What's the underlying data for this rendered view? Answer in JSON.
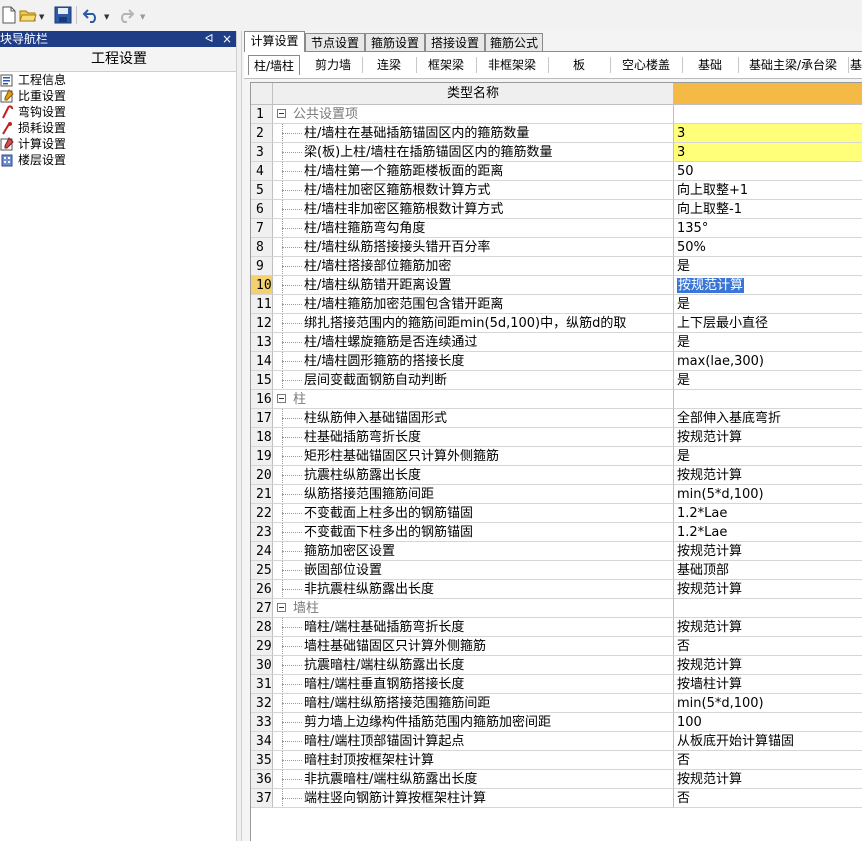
{
  "toolbar": {
    "buttons": [
      {
        "icon": "new-file-icon"
      },
      {
        "icon": "open-folder-icon"
      },
      {
        "icon": "save-icon"
      },
      {
        "icon": "undo-icon"
      },
      {
        "icon": "redo-icon"
      }
    ]
  },
  "nav": {
    "title": "块导航栏",
    "pin_glyph": "ᐊ",
    "close_glyph": "×",
    "header": "工程设置",
    "items": [
      {
        "label": "工程信息",
        "icon": "project-info-icon"
      },
      {
        "label": "比重设置",
        "icon": "weight-settings-icon"
      },
      {
        "label": "弯钩设置",
        "icon": "hook-settings-icon"
      },
      {
        "label": "损耗设置",
        "icon": "loss-settings-icon"
      },
      {
        "label": "计算设置",
        "icon": "calc-settings-icon",
        "selected": true
      },
      {
        "label": "楼层设置",
        "icon": "floor-settings-icon"
      }
    ]
  },
  "tabs_primary": [
    "计算设置",
    "节点设置",
    "箍筋设置",
    "搭接设置",
    "箍筋公式"
  ],
  "tabs_primary_active": 0,
  "tabs_secondary": [
    "柱/墙柱",
    "剪力墙",
    "连梁",
    "框架梁",
    "非框架梁",
    "板",
    "空心楼盖",
    "基础",
    "基础主梁/承台梁",
    "基"
  ],
  "tabs_secondary_active": 0,
  "grid": {
    "header_name": "类型名称",
    "header_value": "",
    "rows": [
      {
        "n": "1",
        "group": true,
        "name": "公共设置项",
        "value": ""
      },
      {
        "n": "2",
        "name": "柱/墙柱在基础插筋锚固区内的箍筋数量",
        "value": "3",
        "yellow": true
      },
      {
        "n": "3",
        "name": "梁(板)上柱/墙柱在插筋锚固区内的箍筋数量",
        "value": "3",
        "yellow": true
      },
      {
        "n": "4",
        "name": "柱/墙柱第一个箍筋距楼板面的距离",
        "value": "50"
      },
      {
        "n": "5",
        "name": "柱/墙柱加密区箍筋根数计算方式",
        "value": "向上取整+1"
      },
      {
        "n": "6",
        "name": "柱/墙柱非加密区箍筋根数计算方式",
        "value": "向上取整-1"
      },
      {
        "n": "7",
        "name": "柱/墙柱箍筋弯勾角度",
        "value": "135°"
      },
      {
        "n": "8",
        "name": "柱/墙柱纵筋搭接接头错开百分率",
        "value": "50%"
      },
      {
        "n": "9",
        "name": "柱/墙柱搭接部位箍筋加密",
        "value": "是"
      },
      {
        "n": "10",
        "name": "柱/墙柱纵筋错开距离设置",
        "value": "按规范计算",
        "selected": true
      },
      {
        "n": "11",
        "name": "柱/墙柱箍筋加密范围包含错开距离",
        "value": "是"
      },
      {
        "n": "12",
        "name": "绑扎搭接范围内的箍筋间距min(5d,100)中，纵筋d的取",
        "value": "上下层最小直径"
      },
      {
        "n": "13",
        "name": "柱/墙柱螺旋箍筋是否连续通过",
        "value": "是"
      },
      {
        "n": "14",
        "name": "柱/墙柱圆形箍筋的搭接长度",
        "value": "max(lae,300)"
      },
      {
        "n": "15",
        "name": "层间变截面钢筋自动判断",
        "value": "是"
      },
      {
        "n": "16",
        "group": true,
        "name": "柱",
        "value": ""
      },
      {
        "n": "17",
        "name": "柱纵筋伸入基础锚固形式",
        "value": "全部伸入基底弯折"
      },
      {
        "n": "18",
        "name": "柱基础插筋弯折长度",
        "value": "按规范计算"
      },
      {
        "n": "19",
        "name": "矩形柱基础锚固区只计算外侧箍筋",
        "value": "是"
      },
      {
        "n": "20",
        "name": "抗震柱纵筋露出长度",
        "value": "按规范计算"
      },
      {
        "n": "21",
        "name": "纵筋搭接范围箍筋间距",
        "value": "min(5*d,100)"
      },
      {
        "n": "22",
        "name": "不变截面上柱多出的钢筋锚固",
        "value": "1.2*Lae"
      },
      {
        "n": "23",
        "name": "不变截面下柱多出的钢筋锚固",
        "value": "1.2*Lae"
      },
      {
        "n": "24",
        "name": "箍筋加密区设置",
        "value": "按规范计算"
      },
      {
        "n": "25",
        "name": "嵌固部位设置",
        "value": "基础顶部"
      },
      {
        "n": "26",
        "name": "非抗震柱纵筋露出长度",
        "value": "按规范计算"
      },
      {
        "n": "27",
        "group": true,
        "name": "墙柱",
        "value": ""
      },
      {
        "n": "28",
        "name": "暗柱/端柱基础插筋弯折长度",
        "value": "按规范计算"
      },
      {
        "n": "29",
        "name": "墙柱基础锚固区只计算外侧箍筋",
        "value": "否"
      },
      {
        "n": "30",
        "name": "抗震暗柱/端柱纵筋露出长度",
        "value": "按规范计算"
      },
      {
        "n": "31",
        "name": "暗柱/端柱垂直钢筋搭接长度",
        "value": "按墙柱计算"
      },
      {
        "n": "32",
        "name": "暗柱/端柱纵筋搭接范围箍筋间距",
        "value": "min(5*d,100)"
      },
      {
        "n": "33",
        "name": "剪力墙上边缘构件插筋范围内箍筋加密间距",
        "value": "100"
      },
      {
        "n": "34",
        "name": "暗柱/端柱顶部锚固计算起点",
        "value": "从板底开始计算锚固"
      },
      {
        "n": "35",
        "name": "暗柱封顶按框架柱计算",
        "value": "否"
      },
      {
        "n": "36",
        "name": "非抗震暗柱/端柱纵筋露出长度",
        "value": "按规范计算"
      },
      {
        "n": "37",
        "name": "端柱竖向钢筋计算按框架柱计算",
        "value": "否"
      }
    ]
  },
  "colors": {
    "nav_title_bg": "#1f3c86",
    "value_header_bg": "#f5b946",
    "yellow_cell": "#ffff7a",
    "selection_bg": "#3a76d6",
    "selected_row_num": "#f5d06e"
  }
}
